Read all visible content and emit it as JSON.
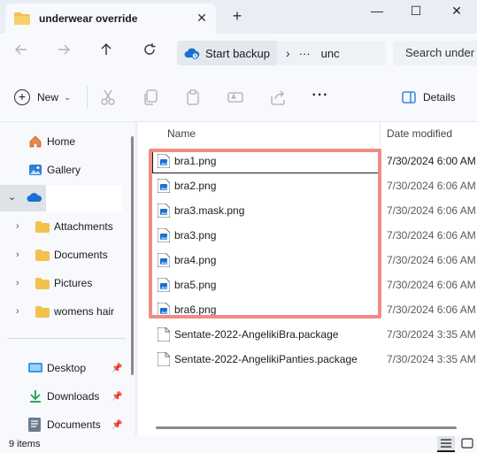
{
  "window": {
    "tab_title": "underwear override",
    "tab_close": "✕",
    "new_tab": "+",
    "minimize": "—",
    "maximize": "☐",
    "close": "✕"
  },
  "address": {
    "backup_label": "Start backup",
    "more_crumbs": "···",
    "crumb": "unc",
    "search_placeholder": "Search under"
  },
  "toolbar": {
    "new_label": "New",
    "more_label": "···",
    "details_label": "Details"
  },
  "sidebar": {
    "items": [
      {
        "label": "Home",
        "icon": "home-icon"
      },
      {
        "label": "Gallery",
        "icon": "gallery-icon"
      },
      {
        "label": "",
        "icon": "onedrive-icon"
      },
      {
        "label": "Attachments",
        "icon": "folder-icon"
      },
      {
        "label": "Documents",
        "icon": "folder-icon"
      },
      {
        "label": "Pictures",
        "icon": "folder-icon"
      },
      {
        "label": "womens hair",
        "icon": "folder-icon"
      },
      {
        "label": "Desktop",
        "icon": "desktop-icon"
      },
      {
        "label": "Downloads",
        "icon": "download-icon"
      },
      {
        "label": "Documents",
        "icon": "documents-icon"
      }
    ]
  },
  "filelist": {
    "columns": {
      "name": "Name",
      "date": "Date modified"
    },
    "rows": [
      {
        "name": "bra1.png",
        "date": "7/30/2024 6:00 AM",
        "type": "image"
      },
      {
        "name": "bra2.png",
        "date": "7/30/2024 6:06 AM",
        "type": "image"
      },
      {
        "name": "bra3.mask.png",
        "date": "7/30/2024 6:06 AM",
        "type": "image"
      },
      {
        "name": "bra3.png",
        "date": "7/30/2024 6:06 AM",
        "type": "image"
      },
      {
        "name": "bra4.png",
        "date": "7/30/2024 6:06 AM",
        "type": "image"
      },
      {
        "name": "bra5.png",
        "date": "7/30/2024 6:06 AM",
        "type": "image"
      },
      {
        "name": "bra6.png",
        "date": "7/30/2024 6:06 AM",
        "type": "image"
      },
      {
        "name": "Sentate-2022-AngelikiBra.package",
        "date": "7/30/2024 3:35 AM",
        "type": "file"
      },
      {
        "name": "Sentate-2022-AngelikiPanties.package",
        "date": "7/30/2024 3:35 AM",
        "type": "file"
      }
    ]
  },
  "status": {
    "item_count": "9 items"
  },
  "colors": {
    "highlight_box": "#f08c84",
    "folder_yellow": "#f2c14e",
    "accent_blue": "#1a6fd0"
  }
}
